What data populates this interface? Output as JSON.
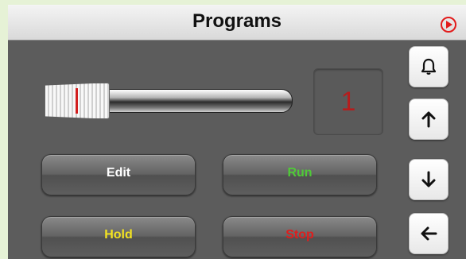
{
  "header": {
    "title": "Programs",
    "icon": "play-circle-icon"
  },
  "slider": {
    "icon": "slider-thumb"
  },
  "counter": {
    "value": "1"
  },
  "buttons": {
    "edit": {
      "label": "Edit",
      "color": "#ffffff"
    },
    "run": {
      "label": "Run",
      "color": "#4fca37"
    },
    "hold": {
      "label": "Hold",
      "color": "#f3e321"
    },
    "stop": {
      "label": "Stop",
      "color": "#e01d1d"
    }
  },
  "side_buttons": [
    {
      "icon": "bell-icon"
    },
    {
      "icon": "arrow-up-icon"
    },
    {
      "icon": "arrow-down-icon"
    },
    {
      "icon": "arrow-left-icon"
    }
  ],
  "colors": {
    "accent": "#e21b1b",
    "panel": "#5c5c5c",
    "frame": "#e6f2d6"
  }
}
